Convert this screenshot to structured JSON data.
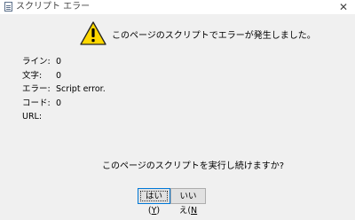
{
  "window": {
    "title": "スクリプト エラー",
    "close_glyph": "✕"
  },
  "dialog": {
    "icon": "warning-icon",
    "message": "このページのスクリプトでエラーが発生しました。",
    "details": [
      {
        "label": "ライン:",
        "value": "0"
      },
      {
        "label": "文字:",
        "value": "0"
      },
      {
        "label": "エラー:",
        "value": "Script error."
      },
      {
        "label": "コード:",
        "value": "0"
      },
      {
        "label": "URL:",
        "value": ""
      }
    ],
    "question": "このページのスクリプトを実行し続けますか?",
    "buttons": {
      "yes_text": "はい(",
      "yes_key": "Y",
      "yes_close": ")",
      "no_text": "いいえ(",
      "no_key": "N",
      "no_close": ""
    }
  },
  "colors": {
    "background": "#f0f0f0",
    "warning_fill": "#ffd800",
    "focus_border": "#0078d7"
  }
}
